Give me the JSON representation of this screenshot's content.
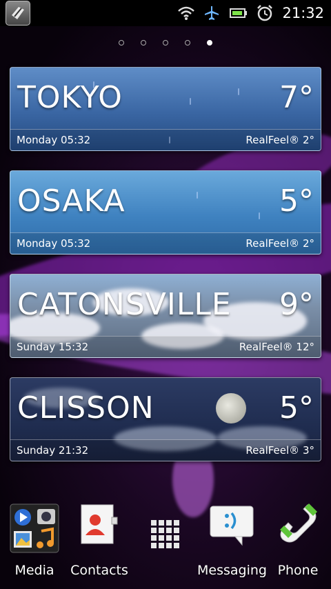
{
  "status_bar": {
    "time": "21:32",
    "icons": [
      "app-shortcut-icon",
      "wifi-icon",
      "airplane-signal-icon",
      "battery-icon",
      "alarm-icon"
    ]
  },
  "home_pages": {
    "count": 5,
    "active_index": 4
  },
  "weather_cards": [
    {
      "city": "TOKYO",
      "temp": "7°",
      "time": "Monday 05:32",
      "realfeel": "RealFeel® 2°",
      "condition": "rain"
    },
    {
      "city": "OSAKA",
      "temp": "5°",
      "time": "Monday 05:32",
      "realfeel": "RealFeel® 2°",
      "condition": "clear"
    },
    {
      "city": "CATONSVILLE",
      "temp": "9°",
      "time": "Sunday 15:32",
      "realfeel": "RealFeel® 12°",
      "condition": "cloudy"
    },
    {
      "city": "CLISSON",
      "temp": "5°",
      "time": "Sunday 21:32",
      "realfeel": "RealFeel® 3°",
      "condition": "night"
    }
  ],
  "dock": [
    {
      "label": "Media",
      "icon": "media-folder-icon"
    },
    {
      "label": "Contacts",
      "icon": "contacts-icon"
    },
    {
      "label": "",
      "icon": "app-drawer-icon"
    },
    {
      "label": "Messaging",
      "icon": "messaging-icon"
    },
    {
      "label": "Phone",
      "icon": "phone-icon"
    }
  ],
  "colors": {
    "accent": "#a63bd6",
    "card_border": "#ffffff"
  }
}
